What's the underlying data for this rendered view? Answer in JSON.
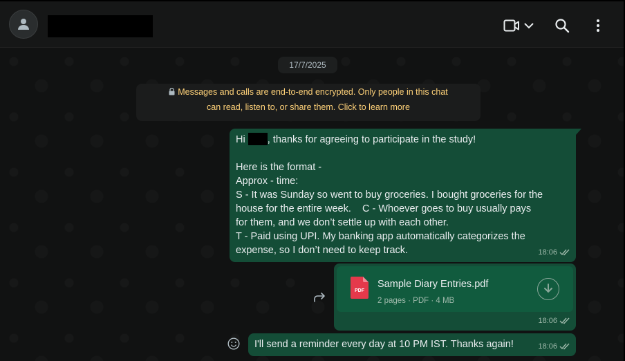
{
  "header": {
    "contact_name": "",
    "icons": [
      "person-icon",
      "video-call-icon",
      "chevron-down-icon",
      "search-icon",
      "menu-icon"
    ]
  },
  "chat": {
    "date_chip": "17/7/2025",
    "encryption_notice_line1": "Messages and calls are end-to-end encrypted. Only people in this chat",
    "encryption_notice_line2": "can read, listen to, or share them. Click to learn more",
    "messages": [
      {
        "lines": [
          {
            "prefix": "Hi ",
            "suffix": ", thanks for agreeing to participate in the study!"
          },
          "",
          "Here is the format -",
          "Approx - time:",
          "S - It was Sunday so went to buy groceries. I bought groceries for the",
          "house for the entire week.    C - Whoever goes to buy usually pays",
          "for them, and we don’t settle up with each other.",
          "T - Paid using UPI. My banking app automatically categorizes the",
          "expense, so I don’t need to keep track."
        ],
        "time": "18:06",
        "status": "delivered"
      },
      {
        "document": {
          "file_name": "Sample Diary Entries.pdf",
          "file_info": "2 pages · PDF · 4 MB",
          "badge": "PDF"
        },
        "time": "18:06",
        "status": "delivered"
      },
      {
        "text": "I'll send a reminder every day at 10 PM IST. Thanks again!",
        "time": "18:06",
        "status": "delivered"
      }
    ]
  },
  "colors": {
    "bubble_outgoing": "#144d37",
    "notice_text": "#ffd279",
    "background": "#111212"
  }
}
